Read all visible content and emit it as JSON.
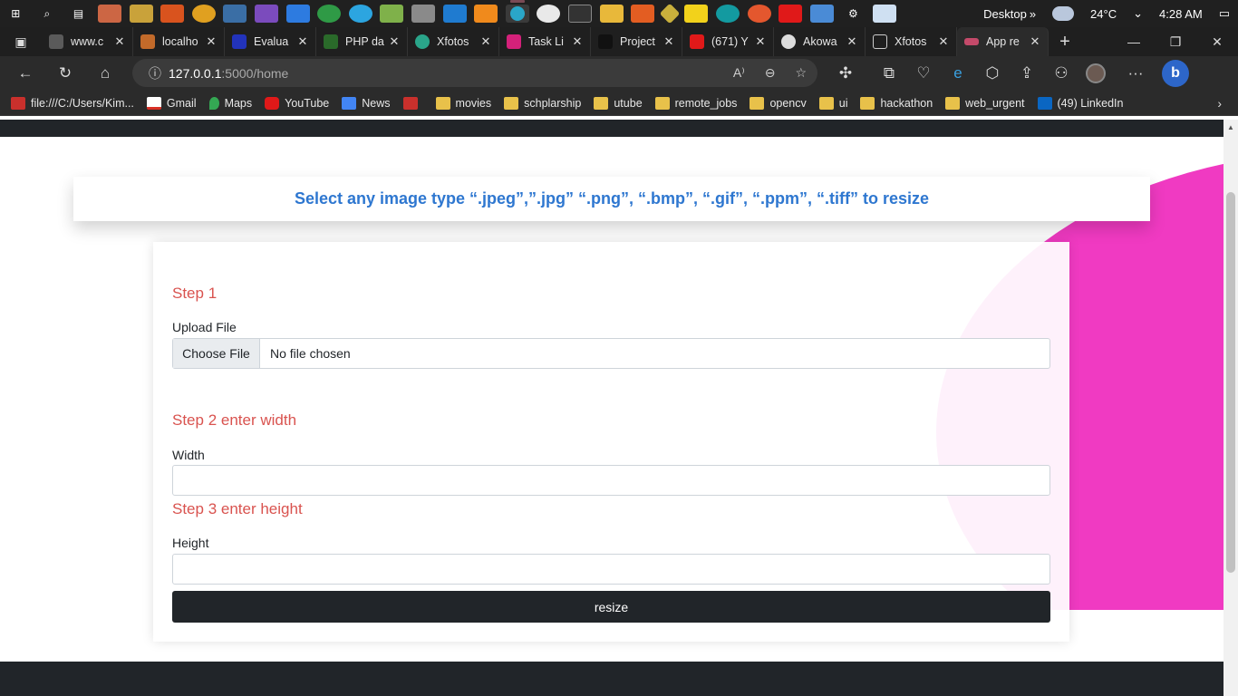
{
  "taskbar": {
    "icons": [
      "windows-start-icon",
      "search-icon",
      "task-view-icon",
      "store-icon",
      "sticky-icon",
      "app-icon",
      "app-icon",
      "app-icon",
      "visual-studio-icon",
      "mail-icon",
      "maps-icon",
      "telegram-icon",
      "app-icon",
      "app-icon",
      "vscode-icon",
      "vlc-icon",
      "edge-icon",
      "slack-icon",
      "terminal-icon",
      "file-explorer-icon",
      "ubuntu-icon",
      "git-icon",
      "sticky-notes-icon",
      "arduino-icon",
      "app-icon",
      "youtube-icon",
      "app-icon",
      "settings-icon",
      "notepad-icon"
    ],
    "desktop_label": "Desktop",
    "chevron": "»",
    "temperature": "24°C",
    "time": "4:28 AM"
  },
  "tabs": [
    {
      "label": "www.c",
      "color": "#5a5a5a"
    },
    {
      "label": "localho",
      "color": "#c26a2a"
    },
    {
      "label": "Evalua",
      "color": "#2233bb"
    },
    {
      "label": "PHP da",
      "color": "#2a6a2a"
    },
    {
      "label": "Xfotos",
      "color": "#2aa58a"
    },
    {
      "label": "Task Li",
      "color": "#d4217a"
    },
    {
      "label": "Project",
      "color": "#111111"
    },
    {
      "label": "(671) Y",
      "color": "#e01919"
    },
    {
      "label": "Akowa",
      "color": "#dddddd"
    },
    {
      "label": "Xfotos",
      "color": "#888888"
    },
    {
      "label": "App re",
      "color": "#c44a6a"
    }
  ],
  "address": {
    "host": "127.0.0.1",
    "path": ":5000/home"
  },
  "bookmarks": [
    {
      "label": "file:///C:/Users/Kim...",
      "kind": "pdf"
    },
    {
      "label": "Gmail",
      "kind": "gmail"
    },
    {
      "label": "Maps",
      "kind": "maps"
    },
    {
      "label": "YouTube",
      "kind": "youtube"
    },
    {
      "label": "News",
      "kind": "news"
    },
    {
      "label": "movies",
      "kind": "folder"
    },
    {
      "label": "schplarship",
      "kind": "folder"
    },
    {
      "label": "utube",
      "kind": "folder"
    },
    {
      "label": "remote_jobs",
      "kind": "folder"
    },
    {
      "label": "opencv",
      "kind": "folder"
    },
    {
      "label": "ui",
      "kind": "folder"
    },
    {
      "label": "hackathon",
      "kind": "folder"
    },
    {
      "label": "web_urgent",
      "kind": "folder"
    },
    {
      "label": "(49) LinkedIn",
      "kind": "linkedin"
    }
  ],
  "main": {
    "banner_text": "Select any image type “.jpeg”,”.jpg” “.png”, “.bmp”, “.gif”, “.ppm”, “.tiff” to resize",
    "step1": "Step 1",
    "upload_label": "Upload File",
    "choose_file": "Choose File",
    "no_file": "No file chosen",
    "step2": "Step 2 enter width",
    "width_label": "Width",
    "width_value": "",
    "step3": "Step 3 enter height",
    "height_label": "Height",
    "height_value": "",
    "submit_label": "resize"
  },
  "colors": {
    "accent_blue": "#2e77d0",
    "step_red": "#d9534f",
    "magenta": "#f03ac2",
    "dark": "#212529"
  }
}
